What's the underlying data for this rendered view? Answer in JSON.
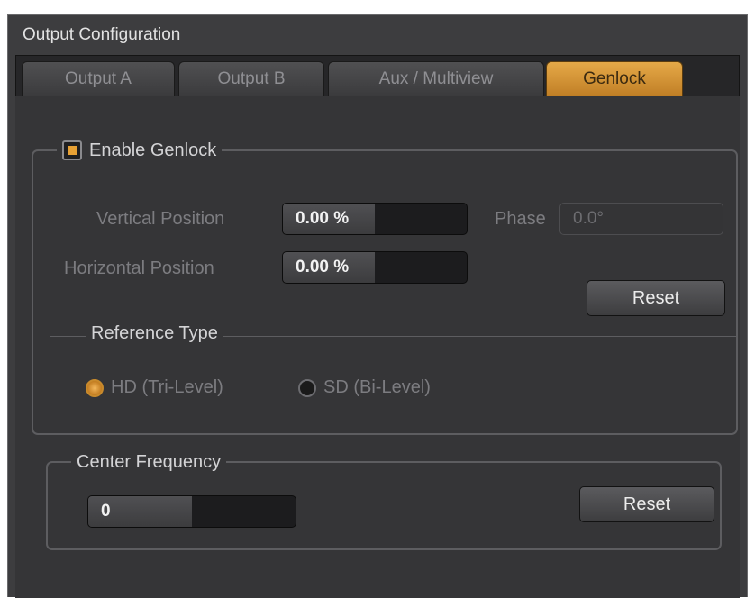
{
  "window": {
    "title": "Output Configuration"
  },
  "tabs": [
    {
      "label": "Output A",
      "active": false
    },
    {
      "label": "Output B",
      "active": false
    },
    {
      "label": "Aux / Multiview",
      "active": false
    },
    {
      "label": "Genlock",
      "active": true
    }
  ],
  "genlock": {
    "enable_label": "Enable Genlock",
    "enabled": true,
    "vertical_position": {
      "label": "Vertical Position",
      "value": "0.00 %",
      "level": 0.5
    },
    "horizontal_position": {
      "label": "Horizontal Position",
      "value": "0.00 %",
      "level": 0.5
    },
    "phase": {
      "label": "Phase",
      "value": "0.0°"
    },
    "reset_label": "Reset",
    "reference_type": {
      "label": "Reference Type",
      "options": [
        {
          "label": "HD (Tri-Level)",
          "selected": true
        },
        {
          "label": "SD (Bi-Level)",
          "selected": false
        }
      ]
    }
  },
  "center_frequency": {
    "label": "Center Frequency",
    "value": "0",
    "level": 0.5,
    "reset_label": "Reset"
  },
  "colors": {
    "accent": "#e6a034",
    "background": "#3d3d3f"
  }
}
